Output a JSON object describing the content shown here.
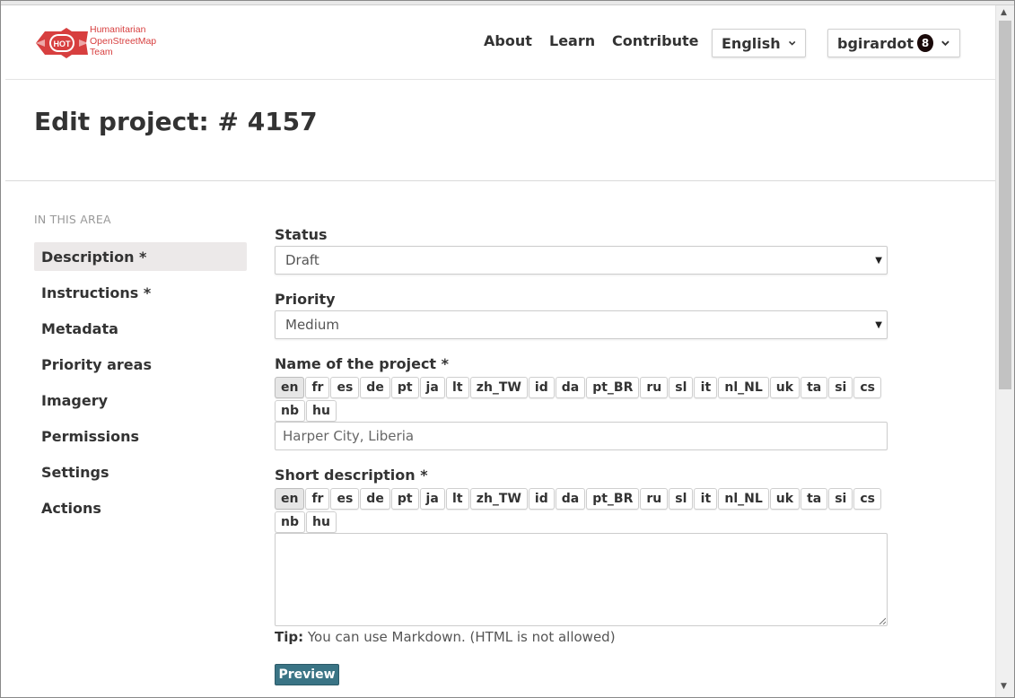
{
  "brand": {
    "logo_abbr": "HOT",
    "name_lines": [
      "Humanitarian",
      "OpenStreetMap",
      "Team"
    ],
    "color": "#d73f3f"
  },
  "nav": {
    "links": [
      "About",
      "Learn",
      "Contribute"
    ],
    "language": "English",
    "user": "bgirardot",
    "notifications": "8"
  },
  "page": {
    "title": "Edit project: # 4157"
  },
  "sidebar": {
    "heading": "IN THIS AREA",
    "items": [
      {
        "label": "Description *",
        "active": true
      },
      {
        "label": "Instructions *"
      },
      {
        "label": "Metadata"
      },
      {
        "label": "Priority areas"
      },
      {
        "label": "Imagery"
      },
      {
        "label": "Permissions"
      },
      {
        "label": "Settings"
      },
      {
        "label": "Actions"
      }
    ]
  },
  "form": {
    "status": {
      "label": "Status",
      "value": "Draft"
    },
    "priority": {
      "label": "Priority",
      "value": "Medium"
    },
    "name": {
      "label": "Name of the project *",
      "value": "Harper City, Liberia"
    },
    "short_description": {
      "label": "Short description *",
      "value": ""
    },
    "languages": [
      "en",
      "fr",
      "es",
      "de",
      "pt",
      "ja",
      "lt",
      "zh_TW",
      "id",
      "da",
      "pt_BR",
      "ru",
      "sl",
      "it",
      "nl_NL",
      "uk",
      "ta",
      "si",
      "cs",
      "nb",
      "hu"
    ],
    "active_language": "en",
    "tip_label": "Tip:",
    "tip_text": " You can use Markdown. (HTML is not allowed)",
    "preview_label": "Preview"
  },
  "colors": {
    "accent": "#3a7485",
    "active_bg": "#ece9e9",
    "brand_red": "#d73f3f"
  }
}
